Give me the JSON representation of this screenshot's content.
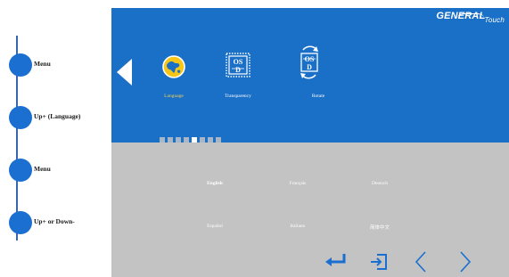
{
  "brand": {
    "name": "GENERAL",
    "sub": "Touch"
  },
  "steps": [
    {
      "label": "Menu"
    },
    {
      "label": "Up+ (Language)"
    },
    {
      "label": "Menu"
    },
    {
      "label": "Up+ or Down-"
    }
  ],
  "menu": {
    "items": [
      {
        "label": "Language",
        "icon": "globe-icon",
        "selected": true
      },
      {
        "label": "Transparency",
        "icon": "osd-transparency-icon"
      },
      {
        "label": "Rotate",
        "icon": "osd-rotate-icon"
      }
    ],
    "page_count": 8,
    "active_page": 5
  },
  "languages": [
    {
      "label": "English",
      "selected": true
    },
    {
      "label": "Français"
    },
    {
      "label": "Deutsch"
    },
    {
      "label": "Español"
    },
    {
      "label": "Italiano"
    },
    {
      "label": "简体中文"
    }
  ],
  "nav": {
    "enter": "enter-icon",
    "exit": "exit-icon",
    "left": "chevron-left-icon",
    "right": "chevron-right-icon"
  },
  "colors": {
    "osd_blue": "#1a6fc6",
    "step_dot": "#1a6fd1",
    "gray": "#c3c3c3",
    "selected_label": "#f2d05a",
    "nav_icon": "#1a6fd1"
  }
}
